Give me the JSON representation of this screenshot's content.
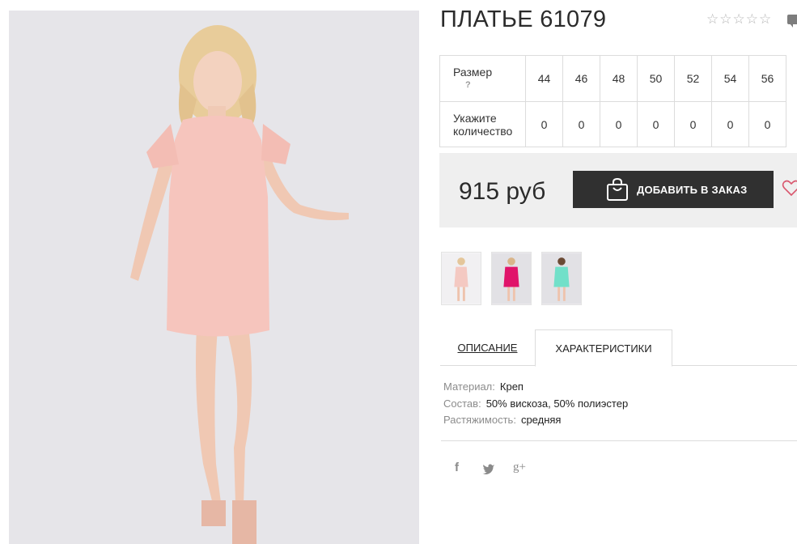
{
  "product": {
    "title": "ПЛАТЬЕ 61079",
    "rating_stars": [
      "☆",
      "☆",
      "☆",
      "☆",
      "☆"
    ]
  },
  "sizes": {
    "size_label": "Размер",
    "help_mark": "?",
    "qty_label": "Укажите количество",
    "values": [
      "44",
      "46",
      "48",
      "50",
      "52",
      "54",
      "56"
    ],
    "quantities": [
      "0",
      "0",
      "0",
      "0",
      "0",
      "0",
      "0"
    ]
  },
  "purchase": {
    "price": "915 руб",
    "add_button": "ДОБАВИТЬ В ЗАКАЗ"
  },
  "thumbnails": [
    {
      "color": "#f4c9c2",
      "bg": "#f1f0f2"
    },
    {
      "color": "#e0146a",
      "bg": "#e2e1e5"
    },
    {
      "color": "#72e0c9",
      "bg": "#e2e1e5"
    }
  ],
  "tabs": {
    "description": "ОПИСАНИЕ",
    "specs": "ХАРАКТЕРИСТИКИ"
  },
  "specs": [
    {
      "key": "Материал:",
      "value": "Креп"
    },
    {
      "key": "Состав:",
      "value": "50% вискоза, 50% полиэстер"
    },
    {
      "key": "Растяжимость:",
      "value": "средняя"
    }
  ],
  "social": {
    "facebook": "f",
    "twitter": "t",
    "google": "g+"
  },
  "colors": {
    "dress": "#f6c5bd",
    "button": "#303030",
    "price_bg": "#efefef",
    "heart": "#d9566d"
  }
}
